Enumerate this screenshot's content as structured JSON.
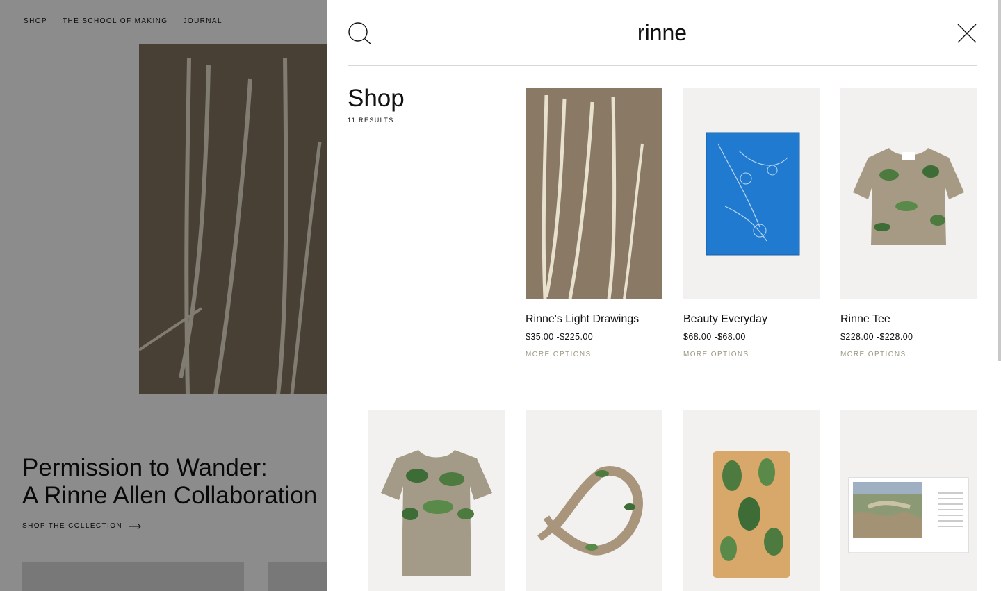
{
  "nav": {
    "items": [
      "SHOP",
      "THE SCHOOL OF MAKING",
      "JOURNAL"
    ]
  },
  "hero": {
    "title": "Permission to Wander:\nA Rinne Allen Collaboration",
    "cta": "SHOP THE COLLECTION"
  },
  "search": {
    "query": "rinne"
  },
  "section": {
    "title": "Shop",
    "count": "11 RESULTS"
  },
  "products": [
    {
      "name": "Rinne's Light Drawings",
      "price": "$35.00 -$225.00",
      "more": "MORE OPTIONS"
    },
    {
      "name": "Beauty Everyday",
      "price": "$68.00 -$68.00",
      "more": "MORE OPTIONS"
    },
    {
      "name": "Rinne Tee",
      "price": "$228.00 -$228.00",
      "more": "MORE OPTIONS"
    }
  ],
  "colors": {
    "accent_muted": "#9a9680",
    "panel_bg": "#ffffff",
    "scrim": "rgba(0,0,0,0.45)"
  }
}
